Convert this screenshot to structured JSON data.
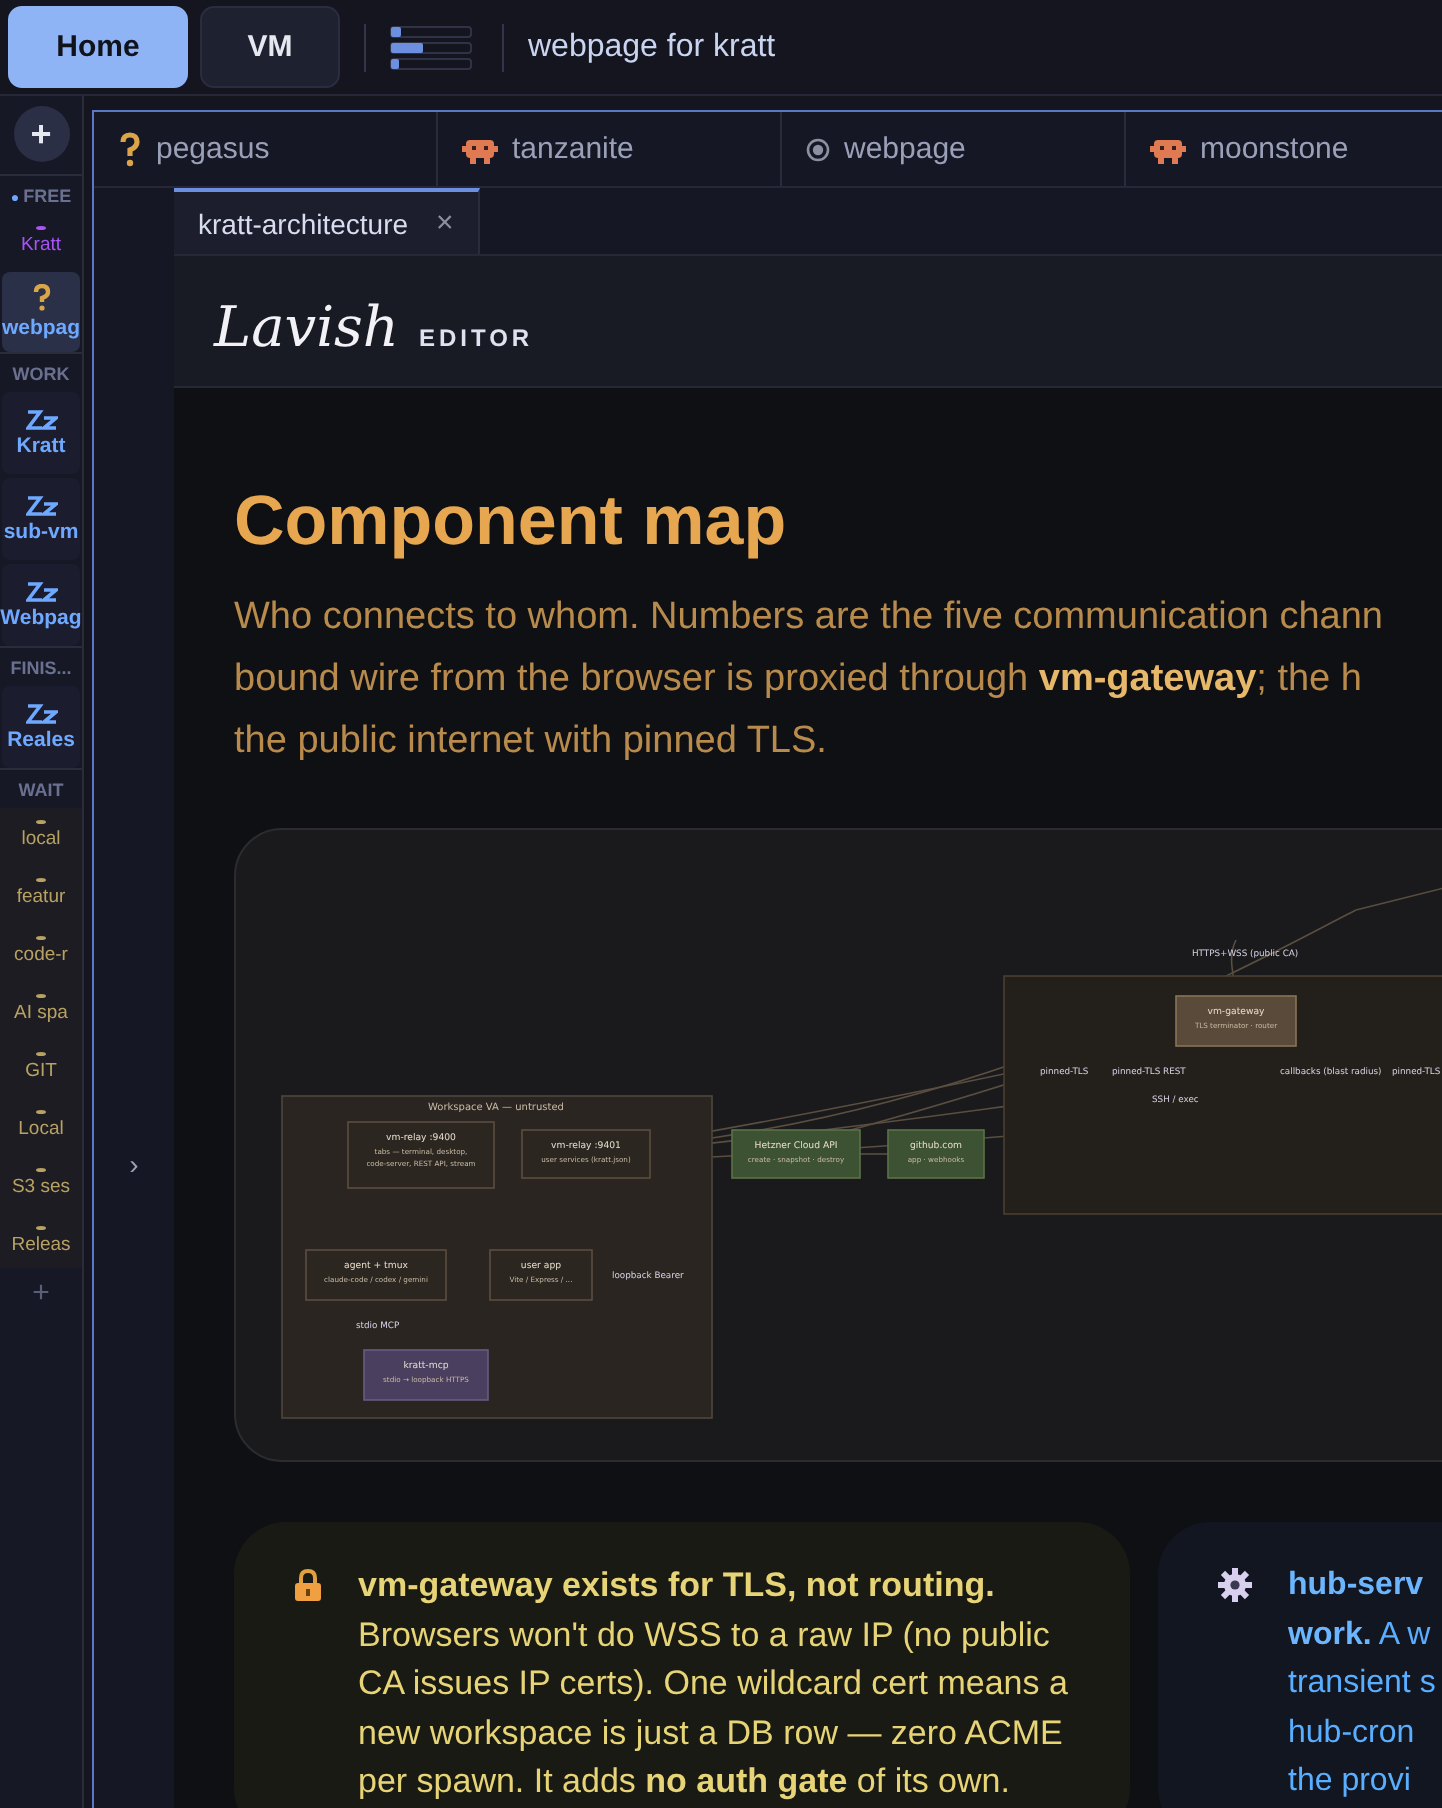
{
  "top_bar": {
    "nav": [
      {
        "label": "Home",
        "selected": true
      },
      {
        "label": "VM",
        "selected": false
      }
    ],
    "title": "webpage for kratt"
  },
  "sidebar": {
    "add": "+",
    "groups": [
      {
        "label": "FREE",
        "marker": "●",
        "items": [
          {
            "kind": "dot",
            "label": "Kratt",
            "color": "#a855f7",
            "selected": false
          },
          {
            "kind": "question",
            "label": "webpag",
            "color": "#6ea8ff",
            "selected": true
          }
        ]
      },
      {
        "label": "WORK",
        "items": [
          {
            "kind": "zz",
            "label": "Kratt",
            "color": "#6ea8ff",
            "selected": false
          },
          {
            "kind": "zz",
            "label": "sub-vm",
            "color": "#6ea8ff",
            "selected": false
          },
          {
            "kind": "zz",
            "label": "Webpag",
            "color": "#6ea8ff",
            "selected": false
          }
        ]
      },
      {
        "label": "FINIS...",
        "items": [
          {
            "kind": "zz",
            "label": "Reales",
            "color": "#6ea8ff",
            "selected": false
          }
        ]
      },
      {
        "label": "WAIT",
        "items": [
          {
            "kind": "dot",
            "label": "local",
            "color": "#b8a263",
            "selected": false
          },
          {
            "kind": "dot",
            "label": "featur",
            "color": "#b8a263",
            "selected": false
          },
          {
            "kind": "dot",
            "label": "code-r",
            "color": "#b8a263",
            "selected": false
          },
          {
            "kind": "dot",
            "label": "AI spa",
            "color": "#b8a263",
            "selected": false
          },
          {
            "kind": "dot",
            "label": "GIT",
            "color": "#b8a263",
            "selected": false
          },
          {
            "kind": "dot",
            "label": "Local",
            "color": "#b8a263",
            "selected": false
          },
          {
            "kind": "dot",
            "label": "S3 ses",
            "color": "#b8a263",
            "selected": false
          },
          {
            "kind": "dot",
            "label": "Releas",
            "color": "#b8a263",
            "selected": false
          }
        ]
      }
    ],
    "footer_add": "+"
  },
  "workspace_tabs": [
    {
      "label": "pegasus",
      "kind": "question"
    },
    {
      "label": "tanzanite",
      "kind": "robot"
    },
    {
      "label": "webpage",
      "kind": "radio"
    },
    {
      "label": "moonstone",
      "kind": "robot"
    }
  ],
  "gutter_toggle": "›",
  "doc_tab": {
    "label": "kratt-architecture",
    "close": "×"
  },
  "editor": {
    "brand": "Lavish",
    "subtitle": "EDITOR"
  },
  "document": {
    "heading": "Component map",
    "intro_lines": [
      "Who connects to whom. Numbers are the five communication chann",
      "bound wire from the browser is proxied through **vm-gateway**; the h",
      "the public internet with pinned TLS."
    ],
    "diagram": {
      "group_title": "Workspace VA — untrusted",
      "nodes": [
        {
          "kind": "node",
          "title": "vm-relay :9400",
          "sub": [
            "tabs — terminal, desktop,",
            "code-server, REST API, stream"
          ]
        },
        {
          "kind": "node",
          "title": "vm-relay :9401",
          "sub": [
            "user services (kratt.json)"
          ]
        },
        {
          "kind": "node",
          "title": "agent + tmux",
          "sub": [
            "claude-code / codex / gemini"
          ]
        },
        {
          "kind": "node",
          "title": "user app",
          "sub": [
            "Vite / Express / ..."
          ]
        },
        {
          "kind": "mcp",
          "title": "kratt-mcp",
          "sub": [
            "stdio → loopback HTTPS"
          ]
        },
        {
          "kind": "external",
          "title": "Hetzner Cloud API",
          "sub": [
            "create · snapshot · destroy"
          ]
        },
        {
          "kind": "external",
          "title": "github.com",
          "sub": [
            "app · webhooks"
          ]
        },
        {
          "kind": "gateway",
          "title": "vm-gateway",
          "sub": [
            "TLS terminator · router"
          ]
        }
      ],
      "labels": [
        "stdio MCP",
        "loopback Bearer",
        "HTTPS+WSS (public CA)",
        "pinned-TLS",
        "pinned-TLS REST",
        "callbacks (blast radius)",
        "pinned-TLS",
        "SSH / exec"
      ]
    },
    "notes": [
      {
        "kind": "lock",
        "lines": [
          "**vm-gateway exists for TLS, not routing.**",
          "Browsers won't do WSS to a raw IP (no public",
          "CA issues IP certs). One wildcard cert means a",
          "new workspace is just a DB row — zero ACME",
          "per spawn. It adds **no auth gate** of its own."
        ]
      },
      {
        "kind": "gear",
        "lines": [
          "**hub-serv**",
          "**work.** A w",
          "transient s",
          "hub-cron",
          "the provi"
        ]
      }
    ]
  }
}
